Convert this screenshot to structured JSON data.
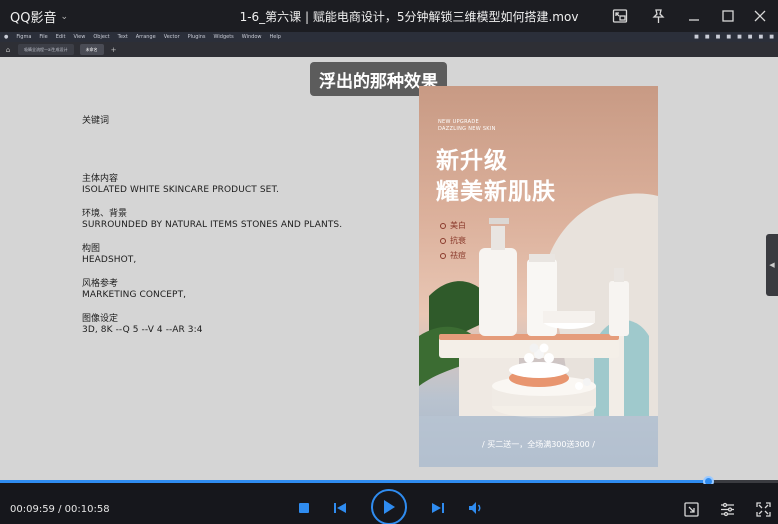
{
  "app": {
    "name": "QQ影音"
  },
  "window": {
    "title": "1-6_第六课 | 赋能电商设计，5分钟解锁三维模型如何搭建.mov"
  },
  "screen": {
    "menubar": [
      "Figma",
      "File",
      "Edit",
      "View",
      "Object",
      "Text",
      "Arrange",
      "Vector",
      "Plugins",
      "Widgets",
      "Window",
      "Help"
    ],
    "tabs": [
      "吸睛全流程—ai生成设计",
      "未命名"
    ]
  },
  "subtitle": "浮出的那种效果",
  "prompt": {
    "keyword_label": "关键词",
    "items": [
      {
        "label": "主体内容",
        "value": "ISOLATED WHITE SKINCARE PRODUCT SET."
      },
      {
        "label": "环境、背景",
        "value": "SURROUNDED BY NATURAL ITEMS STONES AND PLANTS."
      },
      {
        "label": "构图",
        "value": "HEADSHOT,"
      },
      {
        "label": "风格参考",
        "value": "MARKETING CONCEPT,"
      },
      {
        "label": "图像设定",
        "value": "3D, 8K --Q 5 --V 4 --AR 3:4"
      }
    ]
  },
  "poster": {
    "tag_line1": "NEW UPGRADE",
    "tag_line2": "DAZZLING NEW SKIN",
    "headline1": "新升级",
    "headline2": "耀美新肌肤",
    "features": [
      "美白",
      "抗衰",
      "祛痘"
    ],
    "promo": "/ 买二送一，全场满300送300 /"
  },
  "playback": {
    "current_time": "00:09:59",
    "total_time": "00:10:58",
    "time_display": "00:09:59 / 00:10:58",
    "progress": 0.9103
  },
  "colors": {
    "accent": "#2f8cf0",
    "titlebar_bg": "#1c1d22",
    "player_bg": "#16171c",
    "canvas_bg": "#d5d5d5"
  },
  "icons": {
    "titlebar": [
      "picture-in-picture-icon",
      "pin-icon",
      "minimize-icon",
      "maximize-icon",
      "close-icon"
    ],
    "controls": [
      "stop-icon",
      "previous-icon",
      "play-icon",
      "next-icon",
      "volume-icon"
    ],
    "controls_right": [
      "screenshot-icon",
      "settings-sliders-icon",
      "fullscreen-icon"
    ]
  }
}
